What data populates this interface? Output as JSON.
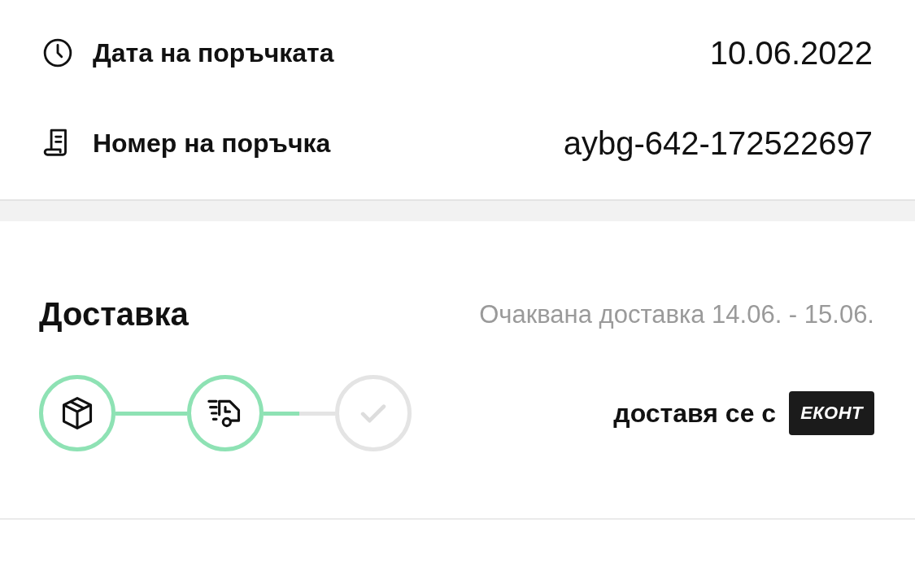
{
  "order_info": [
    {
      "kind": "date",
      "label": "Дата на поръчката",
      "value": "10.06.2022"
    },
    {
      "kind": "number",
      "label": "Номер на поръчка",
      "value": "aybg-642-172522697"
    }
  ],
  "delivery": {
    "title": "Доставка",
    "estimate": "Очаквана доставка 14.06. - 15.06.",
    "steps": [
      {
        "kind": "package",
        "done": true
      },
      {
        "kind": "truck",
        "done": true
      },
      {
        "kind": "check",
        "done": false
      }
    ],
    "carrier_label": "доставя се с",
    "carrier_logo": "ЕКОНТ"
  }
}
